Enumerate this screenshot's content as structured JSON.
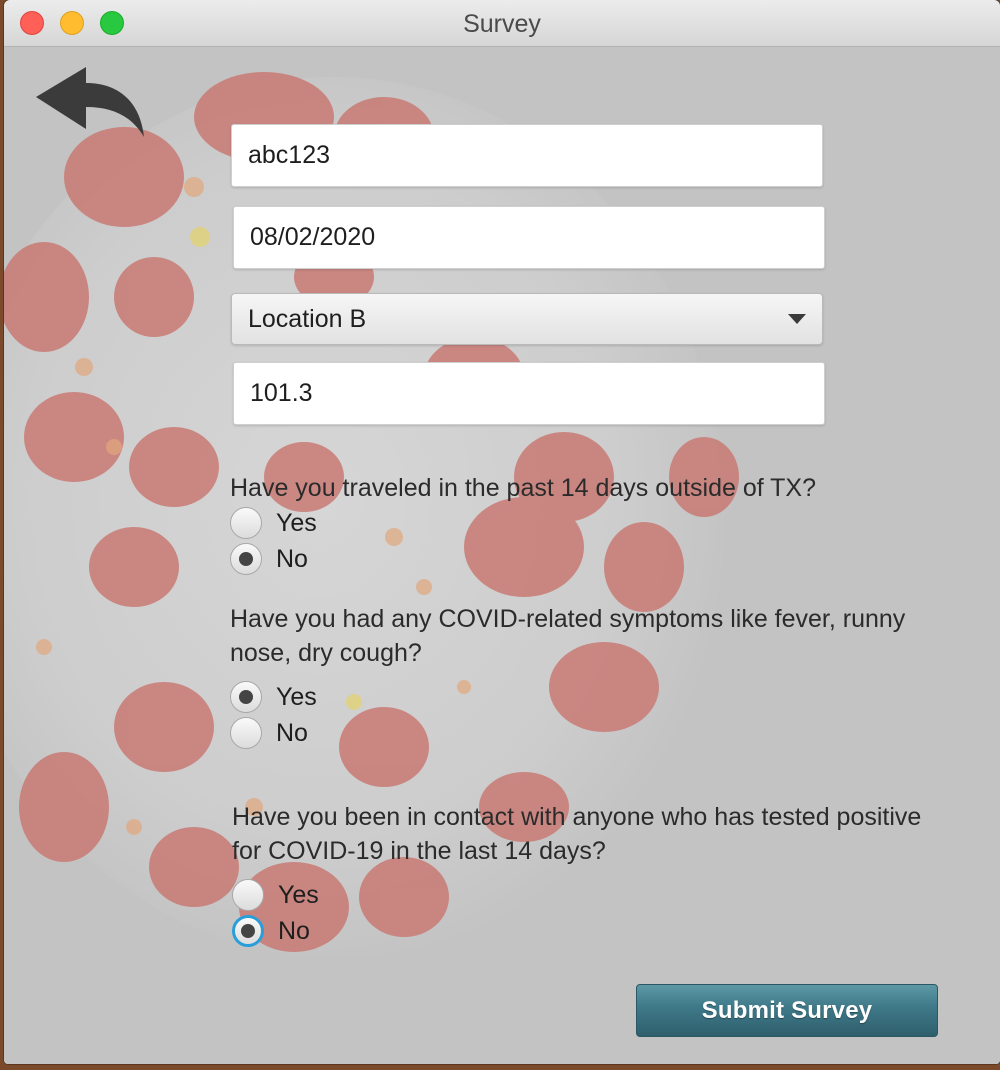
{
  "window": {
    "title": "Survey"
  },
  "form": {
    "user_id": "abc123",
    "date": "08/02/2020",
    "location": "Location B",
    "temperature": "101.3"
  },
  "questions": [
    {
      "text": "Have you traveled in the past 14 days outside of TX?",
      "options": [
        "Yes",
        "No"
      ],
      "selected": "No"
    },
    {
      "text": "Have you had any COVID-related symptoms like fever, runny nose, dry cough?",
      "options": [
        "Yes",
        "No"
      ],
      "selected": "Yes"
    },
    {
      "text": "Have you been in contact with anyone who has tested positive for COVID-19 in the last 14 days?",
      "options": [
        "Yes",
        "No"
      ],
      "selected": "No"
    }
  ],
  "actions": {
    "submit_label": "Submit Survey"
  },
  "icons": {
    "back": "back-arrow-icon",
    "dropdown": "chevron-down-icon"
  },
  "colors": {
    "submit_button": "#3e7888",
    "radio_focus": "#2a9ed8",
    "virus_red": "#c0605a"
  }
}
